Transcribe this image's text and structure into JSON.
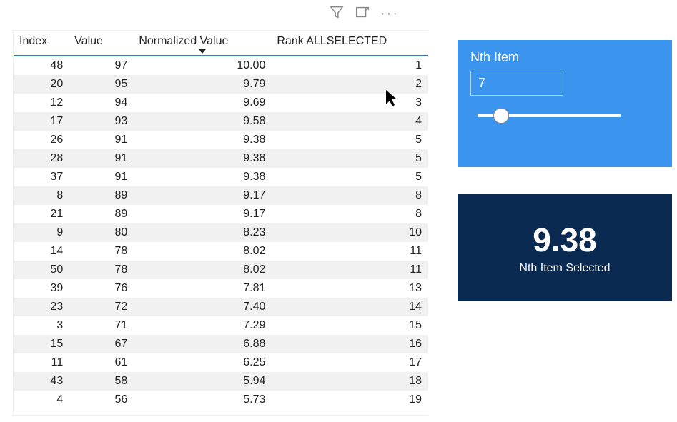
{
  "toolbar": {
    "filter_icon": "filter",
    "focus_icon": "focus-mode",
    "more_icon": "more"
  },
  "table": {
    "columns": [
      "Index",
      "Value",
      "Normalized Value",
      "Rank ALLSELECTED"
    ],
    "sorted_column": 2,
    "rows": [
      {
        "index": 48,
        "value": 97,
        "norm": "10.00",
        "rank": 1
      },
      {
        "index": 20,
        "value": 95,
        "norm": "9.79",
        "rank": 2
      },
      {
        "index": 12,
        "value": 94,
        "norm": "9.69",
        "rank": 3
      },
      {
        "index": 17,
        "value": 93,
        "norm": "9.58",
        "rank": 4
      },
      {
        "index": 26,
        "value": 91,
        "norm": "9.38",
        "rank": 5
      },
      {
        "index": 28,
        "value": 91,
        "norm": "9.38",
        "rank": 5
      },
      {
        "index": 37,
        "value": 91,
        "norm": "9.38",
        "rank": 5
      },
      {
        "index": 8,
        "value": 89,
        "norm": "9.17",
        "rank": 8
      },
      {
        "index": 21,
        "value": 89,
        "norm": "9.17",
        "rank": 8
      },
      {
        "index": 9,
        "value": 80,
        "norm": "8.23",
        "rank": 10
      },
      {
        "index": 14,
        "value": 78,
        "norm": "8.02",
        "rank": 11
      },
      {
        "index": 50,
        "value": 78,
        "norm": "8.02",
        "rank": 11
      },
      {
        "index": 39,
        "value": 76,
        "norm": "7.81",
        "rank": 13
      },
      {
        "index": 23,
        "value": 72,
        "norm": "7.40",
        "rank": 14
      },
      {
        "index": 3,
        "value": 71,
        "norm": "7.29",
        "rank": 15
      },
      {
        "index": 15,
        "value": 67,
        "norm": "6.88",
        "rank": 16
      },
      {
        "index": 11,
        "value": 61,
        "norm": "6.25",
        "rank": 17
      },
      {
        "index": 43,
        "value": 58,
        "norm": "5.94",
        "rank": 18
      },
      {
        "index": 4,
        "value": 56,
        "norm": "5.73",
        "rank": 19
      }
    ]
  },
  "slicer": {
    "title": "Nth Item",
    "value": "7"
  },
  "kpi": {
    "value": "9.38",
    "label": "Nth Item Selected"
  }
}
